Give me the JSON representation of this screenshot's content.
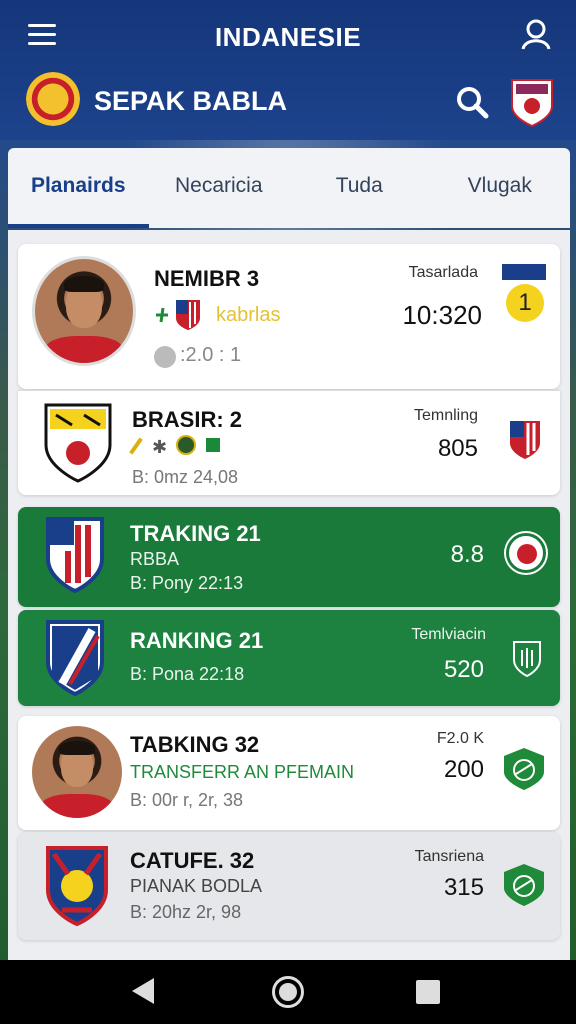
{
  "header": {
    "title": "INDANESIE",
    "brand": "SEPAK BABLA"
  },
  "tabs": [
    {
      "label": "Planairds",
      "active": true
    },
    {
      "label": "Necaricia",
      "active": false
    },
    {
      "label": "Tuda",
      "active": false
    },
    {
      "label": "Vlugak",
      "active": false
    }
  ],
  "cards": [
    {
      "title": "NEMIBR 3",
      "sub1": "kabrlas",
      "sub2": ":2.0 : 1",
      "right_label": "Tasarlada",
      "right_value": "10:320",
      "badge_value": "1"
    },
    {
      "title": "BRASIR: 2",
      "sub2": "B: 0mz 24,08",
      "right_label": "Temnling",
      "right_value": "805"
    },
    {
      "title": "TRAKING 21",
      "sub1": "RBBA",
      "sub2": "B: Pony 22:13",
      "right_value": "8.8"
    },
    {
      "title": "RANKING 21",
      "sub2": "B: Pona 22:18",
      "right_label": "Temlviacin",
      "right_value": "520"
    },
    {
      "title": "TABKING 32",
      "sub1": "TRANSFERR AN PFEMAIN",
      "sub2": "B: 00r r, 2r, 38",
      "right_label": "F2.0 K",
      "right_value": "200"
    },
    {
      "title": "CATUFE. 32",
      "sub1": "PIANAK BODLA",
      "sub2": "B: 20hz 2r, 98",
      "right_label": "Tansriena",
      "right_value": "315"
    }
  ],
  "colors": {
    "header_blue": "#1d438c",
    "accent_blue": "#1a3f8a",
    "card_green": "#1a7a3a",
    "sub_green": "#1f8a3a",
    "badge_yellow": "#f4d21e"
  },
  "icons": [
    "menu-icon",
    "user-icon",
    "search-icon",
    "club-crest-icon",
    "back-icon",
    "home-icon",
    "recent-apps-icon"
  ]
}
